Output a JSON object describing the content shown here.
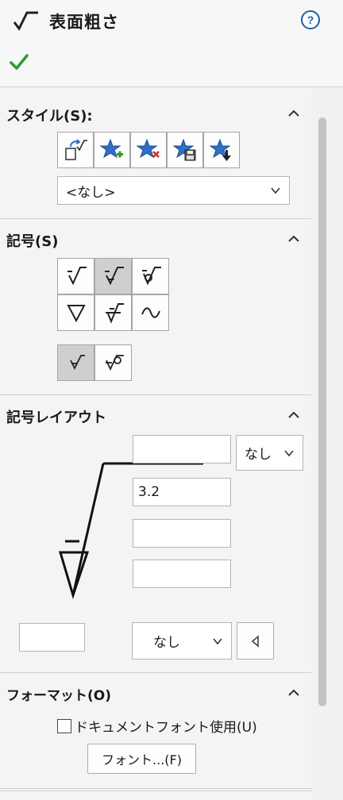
{
  "header": {
    "title": "表面粗さ",
    "title_icon": "surface-finish-icon",
    "help_icon": "help-icon",
    "ok_icon": "checkmark-icon"
  },
  "style_section": {
    "title": "スタイル(S):",
    "buttons": [
      "apply-default-style-icon",
      "add-style-icon",
      "delete-style-icon",
      "save-style-icon",
      "load-style-icon"
    ],
    "dropdown_value": "<なし>"
  },
  "symbol_section": {
    "title": "記号(S)",
    "symbols": [
      "basic-icon",
      "machining-required-icon",
      "machining-prohibited-icon",
      "jis-basic-icon",
      "jis-machining-icon",
      "jis-no-machining-icon"
    ],
    "selected_index": 1
  },
  "layout_section": {
    "title": "記号レイアウト",
    "top_right_select": "なし",
    "roughness_value": "3.2",
    "lay_direction": "なし"
  },
  "format_section": {
    "title": "フォーマット(O)",
    "use_doc_font": "ドキュメントフォント使用(U)",
    "font_button": "フォント...(F)"
  },
  "colors": {
    "ok_green": "#2e9a2e",
    "help_blue": "#1f5fa8",
    "star_blue": "#2f6fc8"
  }
}
